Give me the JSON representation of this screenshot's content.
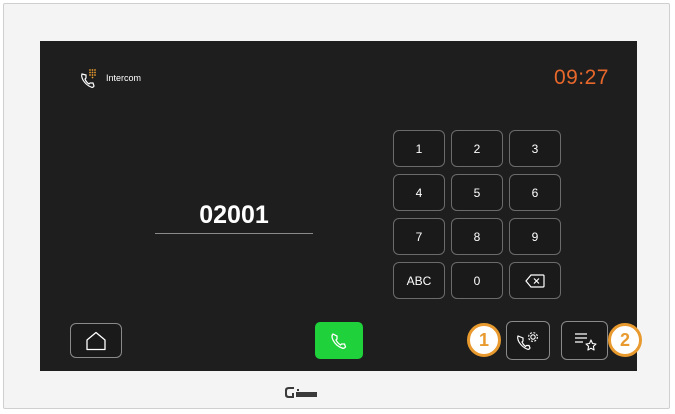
{
  "header": {
    "icon": "intercom-handset-keypad-icon",
    "title": "Intercom",
    "time": "09:27",
    "time_color": "#e8672b"
  },
  "dialer": {
    "number": "02001"
  },
  "keypad": {
    "keys": [
      "1",
      "2",
      "3",
      "4",
      "5",
      "6",
      "7",
      "8",
      "9",
      "ABC",
      "0"
    ],
    "backspace_icon": "backspace-icon"
  },
  "toolbar": {
    "home_icon": "home-icon",
    "call_icon": "phone-icon",
    "call_color": "#1fd13a",
    "call_settings_icon": "phone-settings-icon",
    "favorites_icon": "favorites-list-icon"
  },
  "callouts": {
    "first": "1",
    "second": "2",
    "color": "#e89a2e"
  }
}
